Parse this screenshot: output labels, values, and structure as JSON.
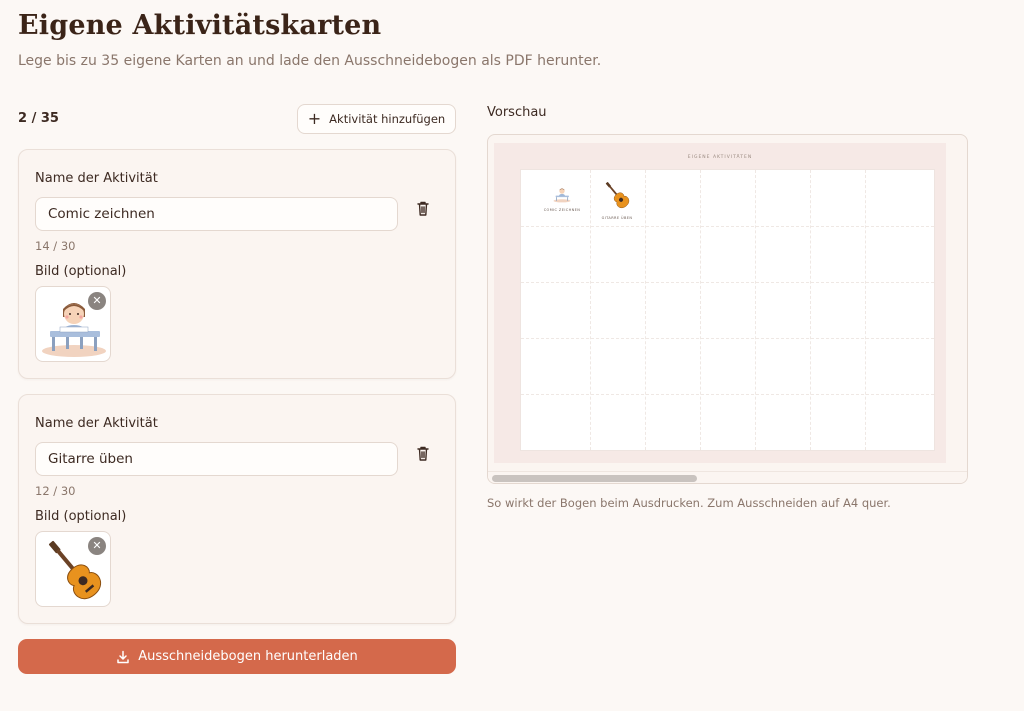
{
  "header": {
    "title": "Eigene Aktivitätskarten",
    "subtitle": "Lege bis zu 35 eigene Karten an und lade den Ausschneidebogen als PDF herunter."
  },
  "editor": {
    "counter": "2 / 35",
    "add_label": "Aktivität hinzufügen",
    "name_label": "Name der Aktivität",
    "image_label": "Bild (optional)",
    "cards": [
      {
        "name": "Comic zeichnen",
        "count": "14 / 30",
        "image": "child-drawing-illustration"
      },
      {
        "name": "Gitarre üben",
        "count": "12 / 30",
        "image": "guitar-illustration"
      }
    ],
    "download_label": "Ausschneidebogen herunterladen"
  },
  "preview": {
    "label": "Vorschau",
    "sheet_title": "EIGENE AKTIVITÄTEN",
    "cards": [
      "COMIC ZEICHNEN",
      "GITARRE ÜBEN"
    ],
    "caption": "So wirkt der Bogen beim Ausdrucken. Zum Ausschneiden auf A4 quer."
  },
  "colors": {
    "accent": "#d4694b",
    "background": "#fcf8f5",
    "card": "#fbf5f1",
    "text": "#3d2a22",
    "muted": "#8a766b"
  }
}
